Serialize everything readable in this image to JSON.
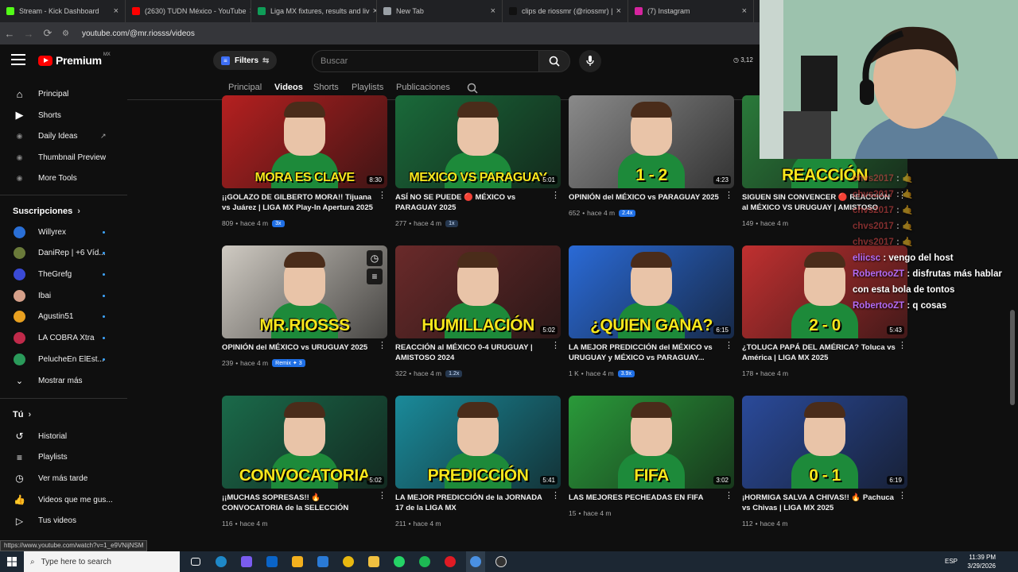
{
  "browser": {
    "tabs": [
      {
        "title": "Stream - Kick Dashboard",
        "color": "#53fc18"
      },
      {
        "title": "(2630) TUDN México - YouTube",
        "color": "#ff0000"
      },
      {
        "title": "Liga MX fixtures, results and liv",
        "color": "#0f9d58"
      },
      {
        "title": "New Tab",
        "color": "#9aa0a6"
      },
      {
        "title": "clips de riossmr (@riossmr) |",
        "color": "#111111"
      },
      {
        "title": "(7) Instagram",
        "color": "#d6249f"
      }
    ],
    "url": "youtube.com/@mr.riosss/videos",
    "status_url": "https://www.youtube.com/watch?v=1_e9VNijNSM"
  },
  "masthead": {
    "logo_text": "Premium",
    "country": "MX",
    "filters_label": "Filters",
    "search_placeholder": "Buscar",
    "timer": "3,12"
  },
  "channel_tabs": [
    "Principal",
    "Videos",
    "Shorts",
    "Playlists",
    "Publicaciones"
  ],
  "active_channel_tab": "Videos",
  "sidebar": {
    "main": [
      {
        "label": "Principal",
        "icon": "home-icon"
      },
      {
        "label": "Shorts",
        "icon": "shorts-icon"
      },
      {
        "label": "Daily Ideas",
        "icon": "extension-icon"
      },
      {
        "label": "Thumbnail Preview",
        "icon": "extension-icon"
      },
      {
        "label": "More Tools",
        "icon": "extension-icon"
      }
    ],
    "subs_header": "Suscripciones",
    "subs": [
      {
        "label": "Willyrex",
        "color": "#2a6fd6"
      },
      {
        "label": "DaniRep | +6 Víd...",
        "color": "#6a7a3a"
      },
      {
        "label": "TheGrefg",
        "color": "#3a4ad6"
      },
      {
        "label": "Ibai",
        "color": "#d6a08a"
      },
      {
        "label": "Agustin51",
        "color": "#e8a020"
      },
      {
        "label": "LA COBRA Xtra",
        "color": "#c02a4a"
      },
      {
        "label": "PelucheEn ElEst...",
        "color": "#2a9a5a"
      }
    ],
    "more": "Mostrar más",
    "you_header": "Tú",
    "you": [
      {
        "label": "Historial",
        "icon": "history-icon"
      },
      {
        "label": "Playlists",
        "icon": "playlist-icon"
      },
      {
        "label": "Ver más tarde",
        "icon": "clock-icon"
      },
      {
        "label": "Videos que me gus...",
        "icon": "thumbs-up-icon"
      },
      {
        "label": "Tus videos",
        "icon": "video-icon"
      }
    ]
  },
  "videos": [
    {
      "title": "¡¡GOLAZO DE GILBERTO MORA!! Tijuana vs Juárez | LIGA MX Play-In Apertura 2025",
      "views": "809",
      "age": "hace 4 m",
      "chip": "3x",
      "chip_style": "blue",
      "duration": "8:30",
      "banner": "MORA ES CLAVE",
      "bg": "#b52020"
    },
    {
      "title": "ASÍ NO SE PUEDE 🔴 MÉXICO vs PARAGUAY 2025",
      "views": "277",
      "age": "hace 4 m",
      "chip": "1x",
      "chip_style": "dark",
      "duration": "5:01",
      "banner": "MEXICO VS PARAGUAY",
      "bg": "#1a6a3a"
    },
    {
      "title": "OPINIÓN del MÉXICO vs PARAGUAY 2025",
      "views": "652",
      "age": "hace 4 m",
      "chip": "2.4x",
      "chip_style": "blue",
      "duration": "4:23",
      "banner": "1 - 2",
      "bg": "#8a8a8a"
    },
    {
      "title": "SIGUEN SIN CONVENCER 🔴 REACCIÓN al MÉXICO VS URUGUAY | AMISTOSO 2025",
      "views": "149",
      "age": "hace 4 m",
      "chip": "",
      "chip_style": "",
      "duration": "",
      "banner": "REACCIÓN",
      "bg": "#2a7a3a"
    },
    {
      "title": "OPINIÓN del MÉXICO vs URUGUAY 2025",
      "views": "239",
      "age": "hace 4 m",
      "chip": "Remix ✦ 3",
      "chip_style": "blue",
      "duration": "",
      "banner": "MR.RIOSSS",
      "bg": "#cfcac2"
    },
    {
      "title": "REACCIÓN al MÉXICO 0-4 URUGUAY | AMISTOSO 2024",
      "views": "322",
      "age": "hace 4 m",
      "chip": "1.2x",
      "chip_style": "dark",
      "duration": "5:02",
      "banner": "HUMILLACIÓN",
      "bg": "#6a2a2a"
    },
    {
      "title": "LA MEJOR PREDICCIÓN del MÉXICO vs URUGUAY y MÉXICO vs PARAGUAY...",
      "views": "1 K",
      "age": "hace 4 m",
      "chip": "3.9x",
      "chip_style": "blue",
      "duration": "6:15",
      "banner": "¿QUIEN GANA?",
      "bg": "#2a6ad6"
    },
    {
      "title": "¿TOLUCA PAPÁ DEL AMÉRICA? Toluca vs América | LIGA MX 2025",
      "views": "178",
      "age": "hace 4 m",
      "chip": "",
      "chip_style": "",
      "duration": "5:43",
      "banner": "2 - 0",
      "bg": "#c03030"
    },
    {
      "title": "¡¡MUCHAS SOPRESAS!! 🔥CONVOCATORIA de la SELECCIÓN MEXICANA",
      "views": "116",
      "age": "hace 4 m",
      "chip": "",
      "chip_style": "",
      "duration": "5:02",
      "banner": "CONVOCATORIA",
      "bg": "#1a6a4a"
    },
    {
      "title": "LA MEJOR PREDICCIÓN de la JORNADA 17 de la LIGA MX",
      "views": "211",
      "age": "hace 4 m",
      "chip": "",
      "chip_style": "",
      "duration": "5:41",
      "banner": "PREDICCIÓN",
      "bg": "#1a8a9a"
    },
    {
      "title": "LAS MEJORES PECHEADAS EN FIFA",
      "views": "15",
      "age": "hace 4 m",
      "chip": "",
      "chip_style": "",
      "duration": "3:02",
      "banner": "FIFA",
      "bg": "#2a9a3a"
    },
    {
      "title": "¡HORMIGA SALVA A CHIVAS!! 🔥 Pachuca vs Chivas | LIGA MX 2025",
      "views": "112",
      "age": "hace 4 m",
      "chip": "",
      "chip_style": "",
      "duration": "6:19",
      "banner": "0 - 1",
      "bg": "#2a4a9a"
    }
  ],
  "chat": [
    {
      "user": "chvs2017",
      "text": "🤙",
      "faded": true
    },
    {
      "user": "chvs2017",
      "text": "🤙",
      "faded": true
    },
    {
      "user": "chvs2017",
      "text": "🤙",
      "faded": true
    },
    {
      "user": "chvs2017",
      "text": "🤙",
      "faded": true
    },
    {
      "user": "chvs2017",
      "text": "🤙",
      "faded": true
    },
    {
      "user": "eliicsc",
      "text": "vengo del host",
      "faded": false
    },
    {
      "user": "RobertooZT",
      "text": "disfrutas más hablar con esta bola de tontos",
      "faded": false
    },
    {
      "user": "RobertooZT",
      "text": "q cosas",
      "faded": false
    }
  ],
  "taskbar": {
    "search_placeholder": "Type here to search",
    "lang": "ESP",
    "time": "11:39 PM",
    "date": "3/29/2026"
  }
}
